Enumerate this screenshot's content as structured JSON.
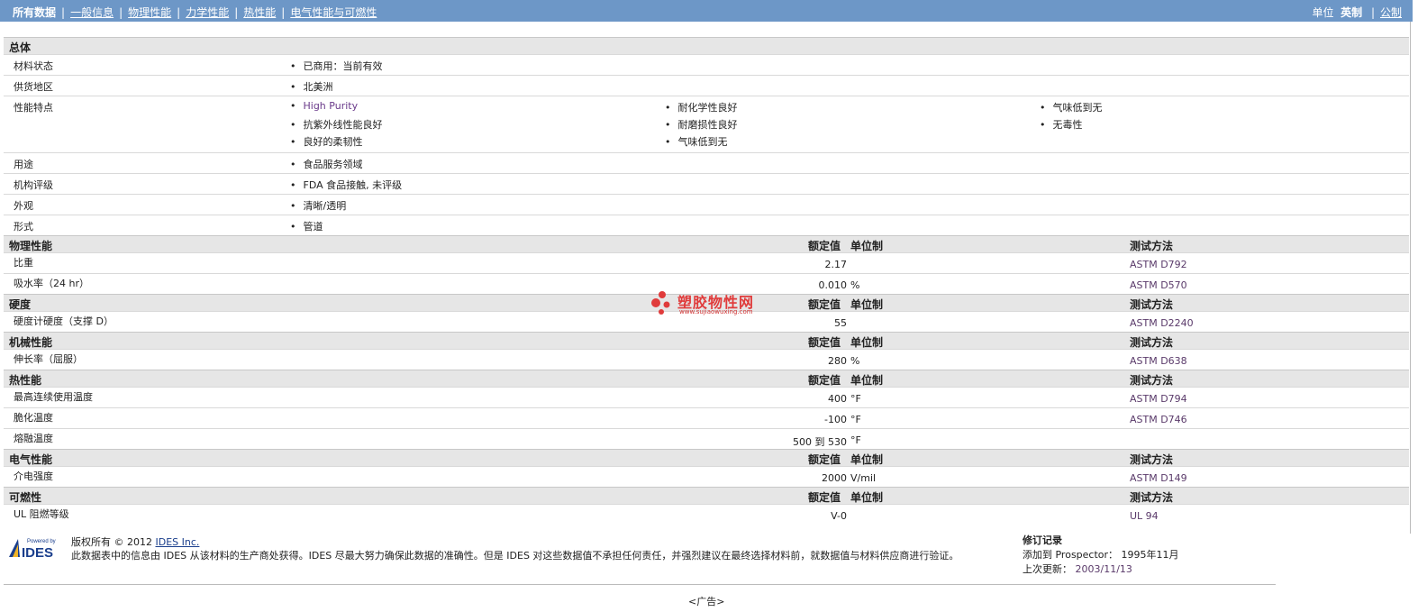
{
  "nav": {
    "tabs": [
      "所有数据",
      "一般信息",
      "物理性能",
      "力学性能",
      "热性能",
      "电气性能与可燃性"
    ],
    "units_label": "单位",
    "unit_english": "英制",
    "unit_metric": "公制",
    "separator": "|"
  },
  "general": {
    "title": "总体",
    "rows": [
      {
        "label": "材料状态",
        "items": [
          [
            "已商用：当前有效"
          ]
        ]
      },
      {
        "label": "供货地区",
        "items": [
          [
            "北美洲"
          ]
        ]
      },
      {
        "label": "性能特点",
        "items": [
          [
            "High Purity",
            "抗紫外线性能良好",
            "良好的柔韧性"
          ],
          [
            "耐化学性良好",
            "耐磨损性良好",
            "气味低到无"
          ],
          [
            "气味低到无",
            "无毒性"
          ]
        ]
      },
      {
        "label": "用途",
        "items": [
          [
            "食品服务领域"
          ]
        ]
      },
      {
        "label": "机构评级",
        "items": [
          [
            "FDA 食品接触, 未评级"
          ]
        ]
      },
      {
        "label": "外观",
        "items": [
          [
            "清晰/透明"
          ]
        ]
      },
      {
        "label": "形式",
        "items": [
          [
            "管道"
          ]
        ]
      }
    ]
  },
  "col_headers": {
    "nominal": "额定值",
    "unit": "单位制",
    "method": "测试方法"
  },
  "sections": [
    {
      "title": "物理性能",
      "rows": [
        {
          "label": "比重",
          "value": "2.17",
          "unit": "",
          "method": "ASTM D792"
        },
        {
          "label": "吸水率（24 hr）",
          "value": "0.010",
          "unit": "%",
          "method": "ASTM D570"
        }
      ]
    },
    {
      "title": "硬度",
      "rows": [
        {
          "label": "硬度计硬度（支撑 D）",
          "value": "55",
          "unit": "",
          "method": "ASTM D2240"
        }
      ]
    },
    {
      "title": "机械性能",
      "rows": [
        {
          "label": "伸长率（屈服）",
          "value": "280",
          "unit": "%",
          "method": "ASTM D638"
        }
      ]
    },
    {
      "title": "热性能",
      "rows": [
        {
          "label": "最高连续使用温度",
          "value": "400",
          "unit": "°F",
          "method": "ASTM D794"
        },
        {
          "label": "脆化温度",
          "value": "-100",
          "unit": "°F",
          "method": "ASTM D746"
        },
        {
          "label": "熔融温度",
          "value": "500 到 530",
          "unit": "°F",
          "method": ""
        }
      ]
    },
    {
      "title": "电气性能",
      "rows": [
        {
          "label": "介电强度",
          "value": "2000",
          "unit": "V/mil",
          "method": "ASTM D149"
        }
      ]
    },
    {
      "title": "可燃性",
      "rows": [
        {
          "label": "UL 阻燃等级",
          "value": "V-0",
          "unit": "",
          "method": "UL 94"
        }
      ]
    }
  ],
  "watermark": {
    "title": "塑胶物性网",
    "url": "www.sujiaowuxing.com"
  },
  "footer": {
    "logo_top": "Powered by",
    "logo_name": "IDES",
    "copyright_prefix": "版权所有 © 2012",
    "copyright_link": "IDES Inc.",
    "disclaimer": "此数据表中的信息由 IDES 从该材料的生产商处获得。IDES 尽最大努力确保此数据的准确性。但是 IDES 对这些数据值不承担任何责任，并强烈建议在最终选择材料前，就数据值与材料供应商进行验证。",
    "revision_title": "修订记录",
    "added_label": "添加到 Prospector：",
    "added_value": "1995年11月",
    "updated_label": "上次更新：",
    "updated_value": "2003/11/13",
    "ad": "<广告>"
  }
}
